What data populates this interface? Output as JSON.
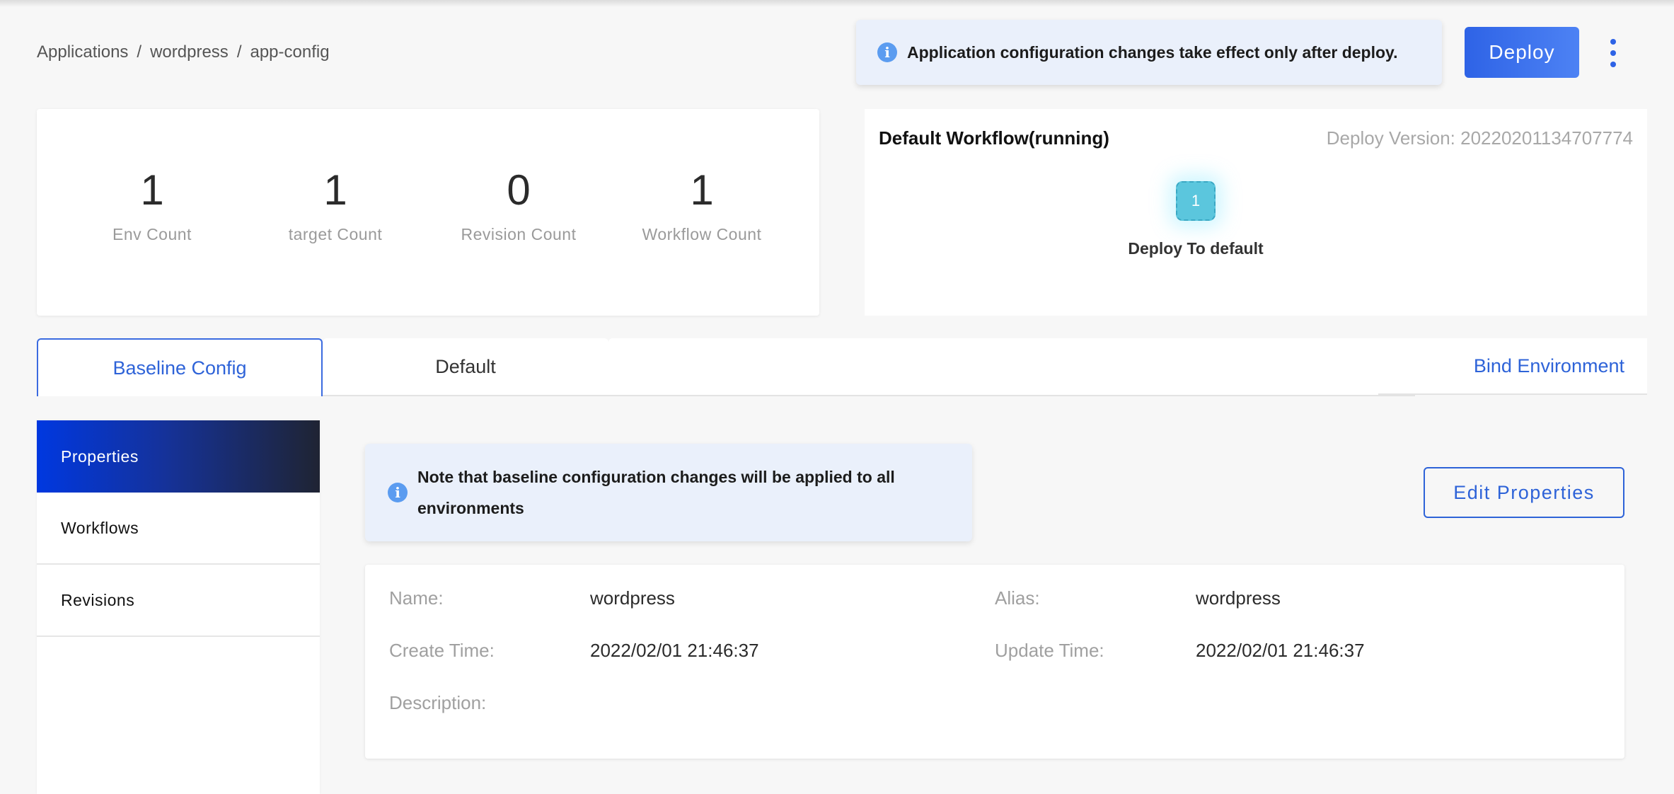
{
  "breadcrumb": {
    "items": [
      "Applications",
      "wordpress",
      "app-config"
    ],
    "separator": "/"
  },
  "header": {
    "notice": "Application configuration changes take effect only after deploy.",
    "deploy_label": "Deploy",
    "more_icon": "more-vertical-icon",
    "accent_color": "#2e63e6"
  },
  "stats": [
    {
      "value": "1",
      "label": "Env Count"
    },
    {
      "value": "1",
      "label": "target Count"
    },
    {
      "value": "0",
      "label": "Revision Count"
    },
    {
      "value": "1",
      "label": "Workflow Count"
    }
  ],
  "workflow": {
    "title": "Default Workflow(running)",
    "deploy_version": "Deploy Version: 20220201134707774",
    "steps": [
      {
        "index": "1",
        "label": "Deploy To default"
      }
    ]
  },
  "tabs": {
    "items": [
      {
        "label": "Baseline Config",
        "active": true
      },
      {
        "label": "Default",
        "active": false
      }
    ],
    "bind_environment_label": "Bind Environment"
  },
  "side_menu": {
    "items": [
      {
        "label": "Properties",
        "active": true
      },
      {
        "label": "Workflows",
        "active": false
      },
      {
        "label": "Revisions",
        "active": false
      }
    ]
  },
  "baseline_notice": "Note that baseline configuration changes will be applied to all environments",
  "edit_properties_label": "Edit Properties",
  "properties": {
    "name_label": "Name:",
    "name_value": "wordpress",
    "alias_label": "Alias:",
    "alias_value": "wordpress",
    "create_time_label": "Create Time:",
    "create_time_value": "2022/02/01 21:46:37",
    "update_time_label": "Update Time:",
    "update_time_value": "2022/02/01 21:46:37",
    "description_label": "Description:",
    "description_value": ""
  }
}
